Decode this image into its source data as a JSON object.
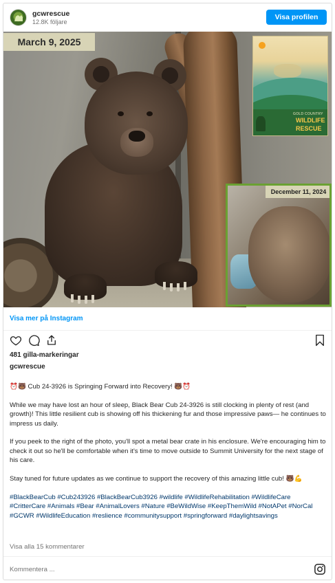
{
  "header": {
    "username": "gcwrescue",
    "followers": "12.8K följare",
    "profile_button": "Visa profilen"
  },
  "photo": {
    "date_main": "March 9, 2025",
    "date_inset": "December 11, 2024",
    "logo": {
      "line1": "GOLD COUNTRY",
      "line2": "WILDLIFE",
      "line3": "RESCUE"
    }
  },
  "view_more": "Visa mer på Instagram",
  "icons": [
    "heart-icon",
    "comment-icon",
    "share-icon",
    "bookmark-icon",
    "instagram-icon"
  ],
  "likes": "481 gilla-markeringar",
  "author": "gcwrescue",
  "caption": {
    "title": "⏰🐻 Cub 24-3926 is Springing Forward into Recovery! 🐻⏰",
    "p1": "While we may have lost an hour of sleep, Black Bear Cub 24-3926 is still clocking in plenty of rest (and growth)! This little resilient cub is showing off his thickening fur and those impressive paws— he continues to impress us daily.",
    "p2": "If you peek to the right of the photo, you'll spot a metal bear crate in his enclosure. We're encouraging him to check it out so he'll be comfortable when it's time to move outside to Summit University for the next stage of his care.",
    "p3": "Stay tuned for future updates as we continue to support the recovery of this amazing little cub! 🐻💪",
    "hashtags": "#BlackBearCub #Cub243926 #BlackBearCub3926 #wildlife #WildlifeRehabilitation #WildlifeCare #CritterCare #Animals #Bear #AnimalLovers #Nature #BeWildWise #KeepThemWild #NotAPet #NorCal #GCWR #WildlifeEducation #reslience #communitysupport #springforward #daylightsavings"
  },
  "comments_link": "Visa alla 15 kommentarer",
  "comment_placeholder": "Kommentera ..."
}
